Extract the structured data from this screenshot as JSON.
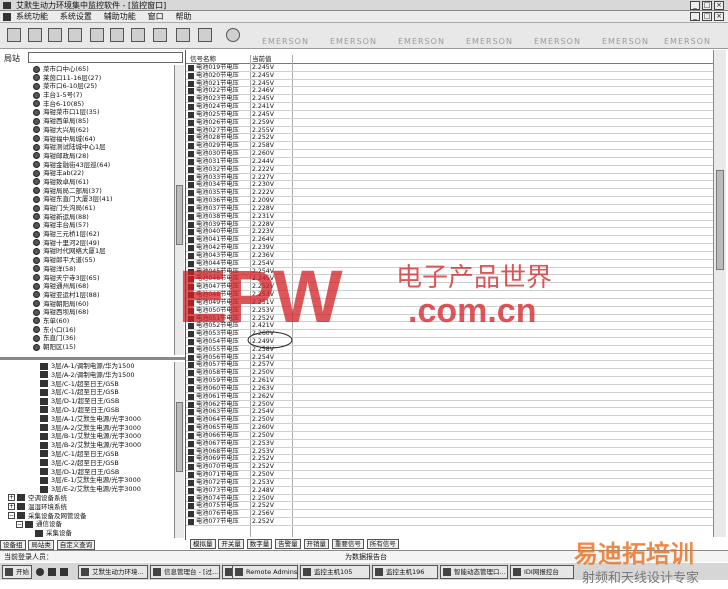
{
  "window": {
    "title": "艾默生动力环境集中监控软件 - [监控窗口]",
    "controls": [
      "_",
      "□",
      "×"
    ]
  },
  "menu": [
    "系统功能",
    "系统设置",
    "辅助功能",
    "窗口",
    "帮助"
  ],
  "toolbar": {
    "watermark": "EMERSON"
  },
  "left": {
    "search_label": "局站",
    "upper_items": [
      "菜市口中心(65)",
      "莱茵口11-16层(27)",
      "菜市口6-10层(25)",
      "丰台1-5号(7)",
      "丰台6-10(85)",
      "海钳菜市口1层(35)",
      "海钳西单局(85)",
      "海钳大兴局(62)",
      "海钳福中局城(64)",
      "海钳测试陆城中心1层",
      "海钳邮政局(28)",
      "海钳金融街43层巡(64)",
      "海钳丰ab(22)",
      "海钳致卓局(61)",
      "海钳局局二部局(37)",
      "海钳东直门大厦3层(41)",
      "海钳门头沟局(61)",
      "海钳新运局(88)",
      "海钳丰台局(57)",
      "海钳三元桥1层(62)",
      "海钳十里河2层(49)",
      "海钳时代网络大厦1层",
      "海钳郎平大道(55)",
      "海钳洋(58)",
      "海钳天宁寺3层(65)",
      "海钳通州局(68)",
      "海钳亚运村1层(88)",
      "海钳朝阳局(60)",
      "海钳西坝局(68)",
      "东单(60)",
      "东小口(16)",
      "东直门(36)",
      "朝阳区(15)"
    ],
    "lower_devices": [
      "3层/A-1/调制电源/华为1500",
      "3层/A-2/调制电源/华为1500",
      "3层/C-1/超至日王/GSB",
      "3层/C-1/超至日王/GSB",
      "3层/D-1/超至日王/GSB",
      "3层/D-1/超至日王/GSB",
      "3层/A-1/艾默生电源/光宇3000",
      "3层/A-2/艾默生电源/光宇3000",
      "3层/B-1/艾默生电源/光宇3000",
      "3层/B-2/艾默生电源/光宇3000",
      "3层/C-1/超至日王/GSB",
      "3层/C-2/超至日王/GSB",
      "3层/D-1/超至日王/GSB",
      "3层/E-1/艾默生电源/光宇3000",
      "3层/E-2/艾默生电源/光宇3000"
    ],
    "tree_nodes": [
      {
        "sign": "+",
        "label": "空调设备系统"
      },
      {
        "sign": "+",
        "label": "温湿环境系统"
      },
      {
        "sign": "−",
        "label": "采集设备及网管设备"
      },
      {
        "sign": "−",
        "label": "通信设备"
      },
      {
        "sign": "",
        "label": "采集设备"
      }
    ],
    "tabs": [
      "设备组",
      "局站类",
      "自定义查询"
    ]
  },
  "table": {
    "columns": [
      "信号名称",
      "当前值"
    ],
    "rows": [
      [
        "电池019节电压",
        "2.245V"
      ],
      [
        "电池020节电压",
        "2.245V"
      ],
      [
        "电池021节电压",
        "2.245V"
      ],
      [
        "电池022节电压",
        "2.246V"
      ],
      [
        "电池023节电压",
        "2.245V"
      ],
      [
        "电池024节电压",
        "2.241V"
      ],
      [
        "电池025节电压",
        "2.245V"
      ],
      [
        "电池026节电压",
        "2.259V"
      ],
      [
        "电池027节电压",
        "2.255V"
      ],
      [
        "电池028节电压",
        "2.252V"
      ],
      [
        "电池029节电压",
        "2.258V"
      ],
      [
        "电池030节电压",
        "2.260V"
      ],
      [
        "电池031节电压",
        "2.244V"
      ],
      [
        "电池032节电压",
        "2.222V"
      ],
      [
        "电池033节电压",
        "2.227V"
      ],
      [
        "电池034节电压",
        "2.230V"
      ],
      [
        "电池035节电压",
        "2.222V"
      ],
      [
        "电池036节电压",
        "2.209V"
      ],
      [
        "电池037节电压",
        "2.228V"
      ],
      [
        "电池038节电压",
        "2.231V"
      ],
      [
        "电池039节电压",
        "2.228V"
      ],
      [
        "电池040节电压",
        "2.223V"
      ],
      [
        "电池041节电压",
        "2.264V"
      ],
      [
        "电池042节电压",
        "2.239V"
      ],
      [
        "电池043节电压",
        "2.236V"
      ],
      [
        "电池044节电压",
        "2.254V"
      ],
      [
        "电池045节电压",
        "2.254V"
      ],
      [
        "电池046节电压",
        "2.245V"
      ],
      [
        "电池047节电压",
        "2.252V"
      ],
      [
        "电池048节电压",
        "2.253V"
      ],
      [
        "电池049节电压",
        "2.251V"
      ],
      [
        "电池050节电压",
        "2.253V"
      ],
      [
        "电池051节电压",
        "2.252V"
      ],
      [
        "电池052节电压",
        "2.421V"
      ],
      [
        "电池053节电压",
        "2.260V"
      ],
      [
        "电池054节电压",
        "2.249V"
      ],
      [
        "电池055节电压",
        "2.258V"
      ],
      [
        "电池056节电压",
        "2.254V"
      ],
      [
        "电池057节电压",
        "2.257V"
      ],
      [
        "电池058节电压",
        "2.250V"
      ],
      [
        "电池059节电压",
        "2.261V"
      ],
      [
        "电池060节电压",
        "2.263V"
      ],
      [
        "电池061节电压",
        "2.262V"
      ],
      [
        "电池062节电压",
        "2.250V"
      ],
      [
        "电池063节电压",
        "2.254V"
      ],
      [
        "电池064节电压",
        "2.250V"
      ],
      [
        "电池065节电压",
        "2.260V"
      ],
      [
        "电池066节电压",
        "2.250V"
      ],
      [
        "电池067节电压",
        "2.253V"
      ],
      [
        "电池068节电压",
        "2.253V"
      ],
      [
        "电池069节电压",
        "2.252V"
      ],
      [
        "电池070节电压",
        "2.252V"
      ],
      [
        "电池071节电压",
        "2.250V"
      ],
      [
        "电池072节电压",
        "2.253V"
      ],
      [
        "电池073节电压",
        "2.248V"
      ],
      [
        "电池074节电压",
        "2.250V"
      ],
      [
        "电池075节电压",
        "2.252V"
      ],
      [
        "电池076节电压",
        "2.256V"
      ],
      [
        "电池077节电压",
        "2.252V"
      ]
    ],
    "highlight_row": 33,
    "tabs": [
      "模拟量",
      "开关量",
      "数字量",
      "告警量",
      "开销量",
      "重要信号",
      "所有信号"
    ]
  },
  "statusbar": {
    "user": "当前登录人员：",
    "center": "为数据报告台"
  },
  "taskbar": {
    "start": "开始",
    "tasks": [
      "艾默生动力环境...",
      "信息管理台 - [过...",
      "",
      "Remote Adminstra...",
      "监控主机105",
      "监控主机196",
      "智能动态管理口...",
      "IDI网报控台"
    ]
  },
  "watermark": {
    "epw": "EPW",
    "cn": "电子产品世界",
    "com": ".com.cn",
    "site": "易迪拓培训",
    "slogan": "射频和天线设计专家"
  },
  "colors": {
    "watermark_red": "#d21f24",
    "watermark_orange": "#e8772b"
  }
}
